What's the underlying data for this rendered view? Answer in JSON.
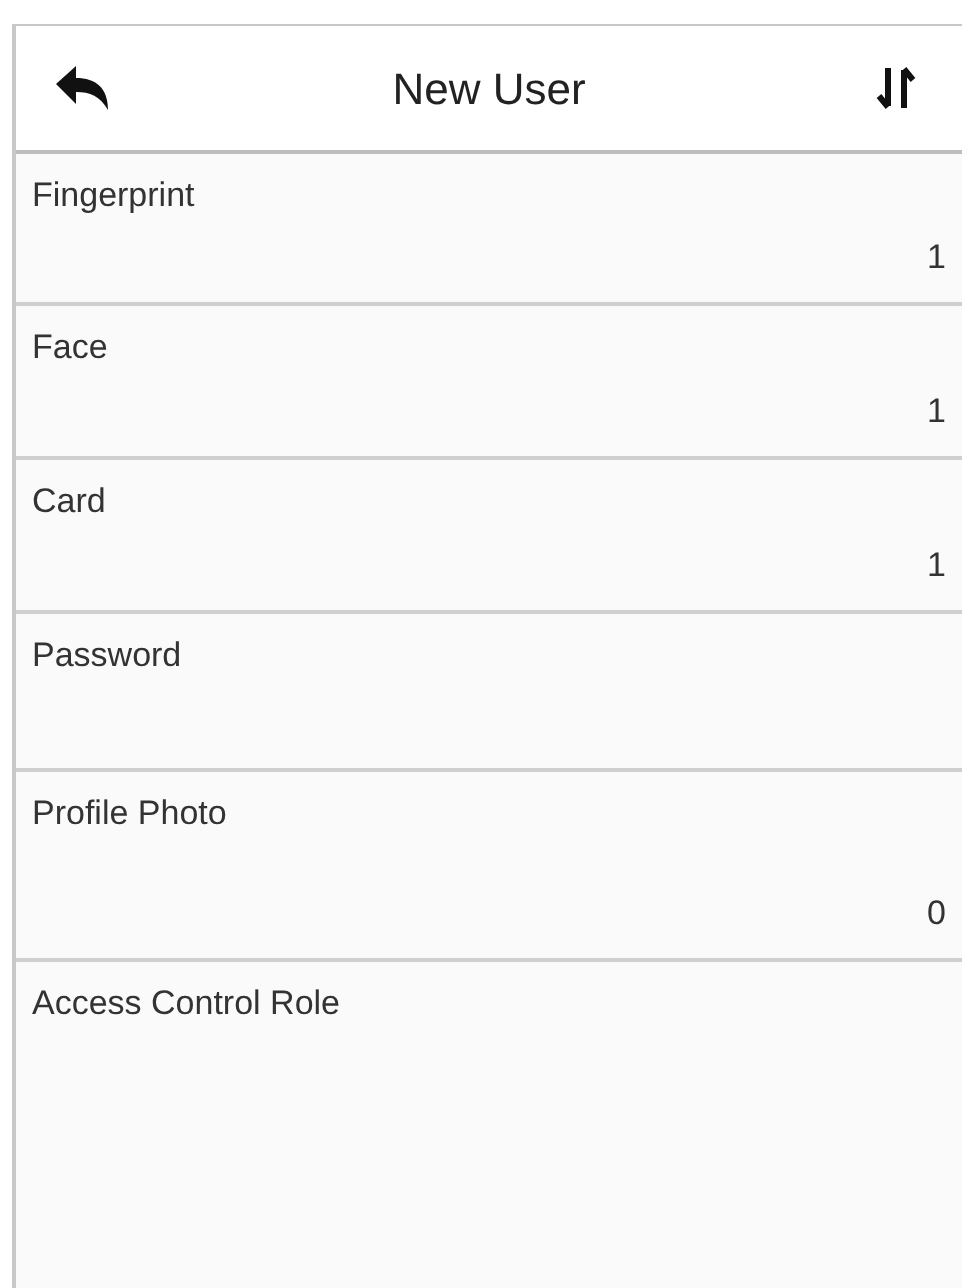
{
  "header": {
    "title": "New User"
  },
  "items": [
    {
      "label": "Fingerprint",
      "value": "1"
    },
    {
      "label": "Face",
      "value": "1"
    },
    {
      "label": "Card",
      "value": "1"
    },
    {
      "label": "Password"
    },
    {
      "label": "Profile Photo",
      "value": "0"
    },
    {
      "label": "Access Control Role"
    }
  ]
}
